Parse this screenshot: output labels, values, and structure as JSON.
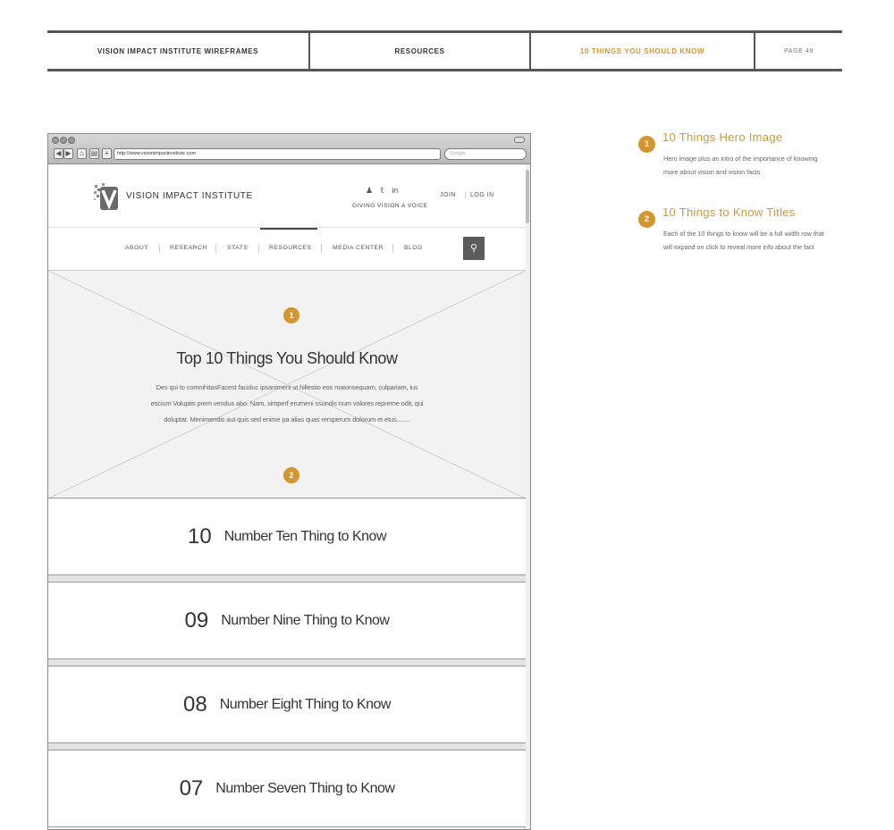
{
  "header": {
    "project": "VISION IMPACT INSTITUTE WIREFRAMES",
    "section": "RESOURCES",
    "page_title": "10 THINGS YOU SHOULD KNOW",
    "page_number": "PAGE 49"
  },
  "browser": {
    "url": "http://www.visionimpactinstitute.com",
    "search_placeholder": "Google",
    "nav_buttons": [
      "◀",
      "▶",
      "⌂",
      "▤",
      "+"
    ]
  },
  "site": {
    "logo_text": "VISION IMPACT INSTITUTE",
    "social": [
      "♟",
      "🐦",
      "in"
    ],
    "tagline": "GIVING VISION A VOICE",
    "join": "JOIN",
    "login": "LOG IN",
    "nav": [
      "ABOUT",
      "RESEARCH",
      "STATS",
      "RESOURCES",
      "MEDIA CENTER",
      "BLOG"
    ],
    "active_nav": "RESOURCES",
    "search_icon": "⚲"
  },
  "hero": {
    "marker1": "1",
    "marker2": "2",
    "title": "Top 10 Things You Should Know",
    "body": "Des qui to comnihitasFacest faciduc ipsanimeni ut hillestio eos maionsequam, culpariam, ius escium Voluptis prem vendus abo. Nam, simperf erumeni ssundis num volores repreme odit, qui doluptat. Menimendis aut quis sed enime pa alias quas rersperum dolorum et etus........"
  },
  "things": [
    {
      "number": "10",
      "label": "Number Ten Thing to Know"
    },
    {
      "number": "09",
      "label": "Number Nine Thing to Know"
    },
    {
      "number": "08",
      "label": "Number Eight Thing to Know"
    },
    {
      "number": "07",
      "label": "Number Seven Thing to Know"
    }
  ],
  "annotations": [
    {
      "marker": "1",
      "title": "10 Things Hero Image",
      "desc": "Hero image plus an intro of the importance of knowing more about vision and vision facts"
    },
    {
      "marker": "2",
      "title": "10 Things to Know Titles",
      "desc": "Each of the 10 things to know will be a full width row that will expand on click to reveal more info about the fact"
    }
  ],
  "colors": {
    "accent": "#d4962f",
    "rule": "#555555"
  }
}
